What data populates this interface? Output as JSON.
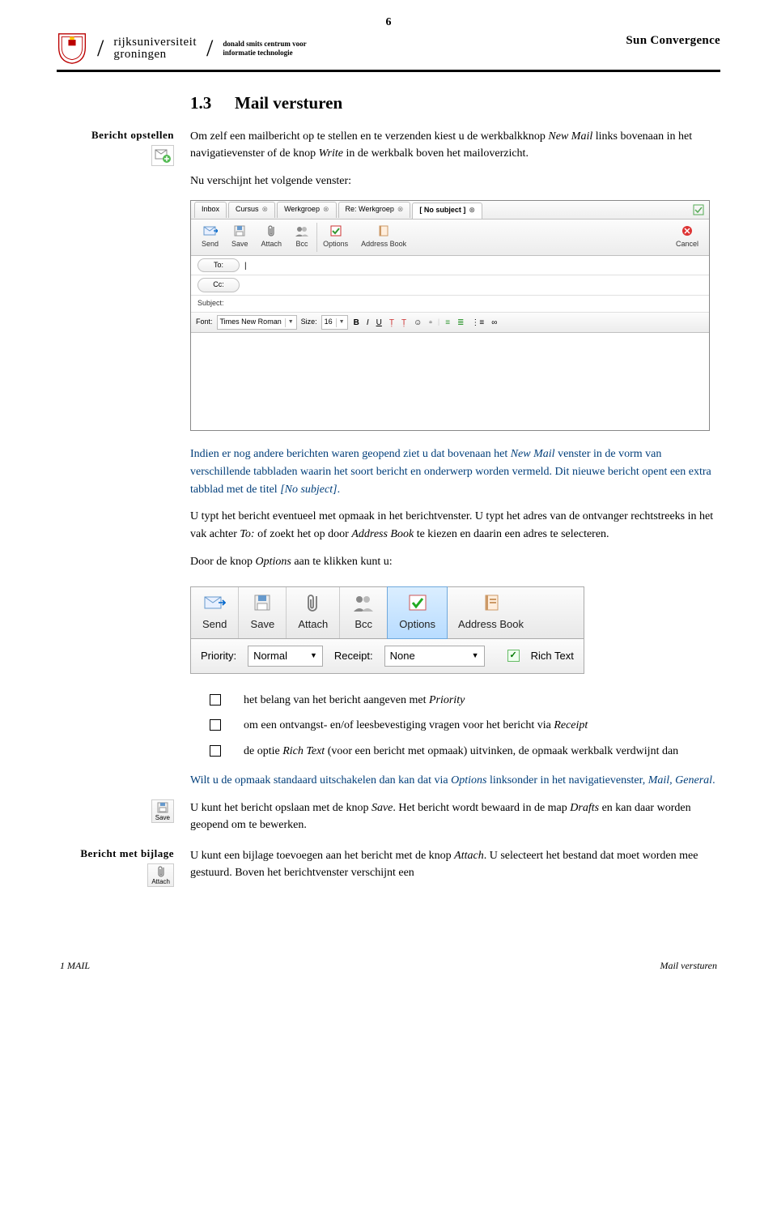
{
  "page_number": "6",
  "header": {
    "university_line1": "rijksuniversiteit",
    "university_line2": "groningen",
    "dept_line1": "donald smits centrum voor",
    "dept_line2": "informatie technologie",
    "right": "Sun Convergence"
  },
  "section": {
    "number": "1.3",
    "title": "Mail versturen"
  },
  "margin": {
    "label1": "Bericht opstellen",
    "label2": "Bericht met bijlage",
    "save_label": "Save",
    "attach_label": "Attach"
  },
  "body": {
    "p1a": "Om zelf een mailbericht op te stellen en te verzenden kiest u de werkbalkknop ",
    "p1_italic1": "New Mail",
    "p1b": " links bovenaan in het navigatievenster of de knop ",
    "p1_italic2": "Write",
    "p1c": " in de werkbalk boven het mailoverzicht.",
    "p2": "Nu verschijnt het volgende venster:",
    "note1a": "Indien er nog andere berichten waren geopend ziet u dat bovenaan het ",
    "note1_italic1": "New Mail",
    "note1b": " venster in de vorm van verschillende tabbladen waarin het soort bericht en onderwerp worden vermeld. Dit nieuwe bericht opent een extra tabblad met de titel ",
    "note1_italic2": "[No subject]",
    "note1c": ".",
    "p3a": "U typt het bericht eventueel met opmaak in het berichtvenster. U typt het adres van de ontvanger rechtstreeks in het vak achter ",
    "p3_italic1": "To:",
    "p3b": " of zoekt het op door ",
    "p3_italic2": "Address Book",
    "p3c": " te kiezen en daarin een adres te selecteren.",
    "p4a": "Door de knop ",
    "p4_italic1": "Options",
    "p4b": " aan te klikken kunt u:",
    "bullets": {
      "b1a": "het belang van het bericht aangeven met ",
      "b1_italic": "Priority",
      "b2a": "om een ontvangst- en/of leesbevestiging vragen voor het bericht via ",
      "b2_italic": "Receipt",
      "b3a": "de optie ",
      "b3_italic": "Rich Text",
      "b3b": " (voor een bericht met opmaak) uitvinken, de opmaak werkbalk verdwijnt dan"
    },
    "note2a": "Wilt u de opmaak standaard uitschakelen dan kan dat via ",
    "note2_italic1": "Options",
    "note2b": " linksonder in het navigatievenster, ",
    "note2_italic2": "Mail, General",
    "note2c": ".",
    "p5a": "U kunt het bericht opslaan met de knop ",
    "p5_italic1": "Save",
    "p5b": ". Het bericht wordt bewaard in de map ",
    "p5_italic2": "Drafts",
    "p5c": " en kan daar worden geopend om te bewerken.",
    "p6a": "U kunt een bijlage toevoegen aan het bericht met de knop ",
    "p6_italic1": "Attach",
    "p6b": ". U selecteert het bestand dat moet worden mee gestuurd. Boven het berichtvenster verschijnt een"
  },
  "compose": {
    "tabs": [
      "Inbox",
      "Cursus",
      "Werkgroep",
      "Re: Werkgroep",
      "[ No subject ]"
    ],
    "toolbar": {
      "send": "Send",
      "save": "Save",
      "attach": "Attach",
      "bcc": "Bcc",
      "options": "Options",
      "addressbook": "Address Book",
      "cancel": "Cancel"
    },
    "fields": {
      "to": "To:",
      "cc": "Cc:",
      "subject": "Subject:"
    },
    "format": {
      "font_label": "Font:",
      "font_value": "Times New Roman",
      "size_label": "Size:",
      "size_value": "16"
    }
  },
  "options_strip": {
    "send": "Send",
    "save": "Save",
    "attach": "Attach",
    "bcc": "Bcc",
    "options": "Options",
    "addressbook": "Address Book",
    "priority_label": "Priority:",
    "priority_value": "Normal",
    "receipt_label": "Receipt:",
    "receipt_value": "None",
    "richtext": "Rich Text"
  },
  "footer": {
    "left": "1 MAIL",
    "right": "Mail versturen"
  }
}
